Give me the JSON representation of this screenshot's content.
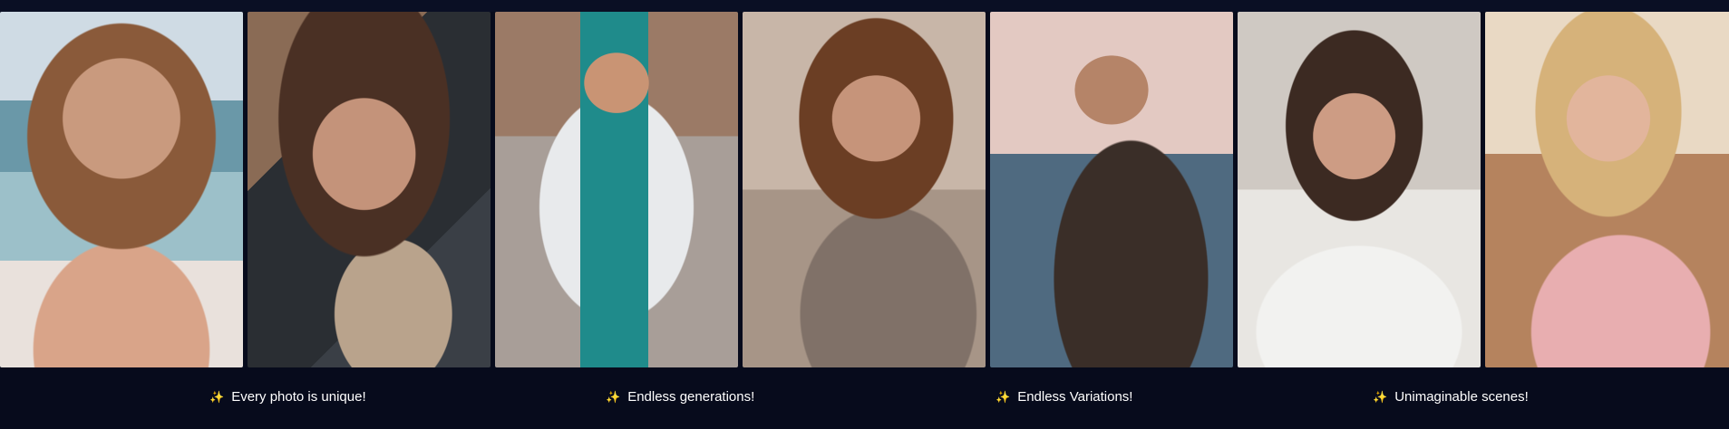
{
  "gallery": {
    "photos": [
      {
        "alt": "woman in orange bikini on beach"
      },
      {
        "alt": "woman in car seat"
      },
      {
        "alt": "man in white t-shirt on street"
      },
      {
        "alt": "woman with camera and scarf"
      },
      {
        "alt": "man in tuxedo by the sea"
      },
      {
        "alt": "woman lying on bed"
      },
      {
        "alt": "blonde woman with glasses in pink blazer"
      }
    ]
  },
  "captions": [
    {
      "icon": "sparkle-icon",
      "glyph": "✨",
      "text": "Every photo is unique!"
    },
    {
      "icon": "sparkle-icon",
      "glyph": "✨",
      "text": "Endless generations!"
    },
    {
      "icon": "sparkle-icon",
      "glyph": "✨",
      "text": "Endless Variations!"
    },
    {
      "icon": "sparkle-icon",
      "glyph": "✨",
      "text": "Unimaginable scenes!"
    }
  ],
  "colors": {
    "background": "#070b1c",
    "caption_text": "#ffffff",
    "sparkle": "#f4c431"
  }
}
